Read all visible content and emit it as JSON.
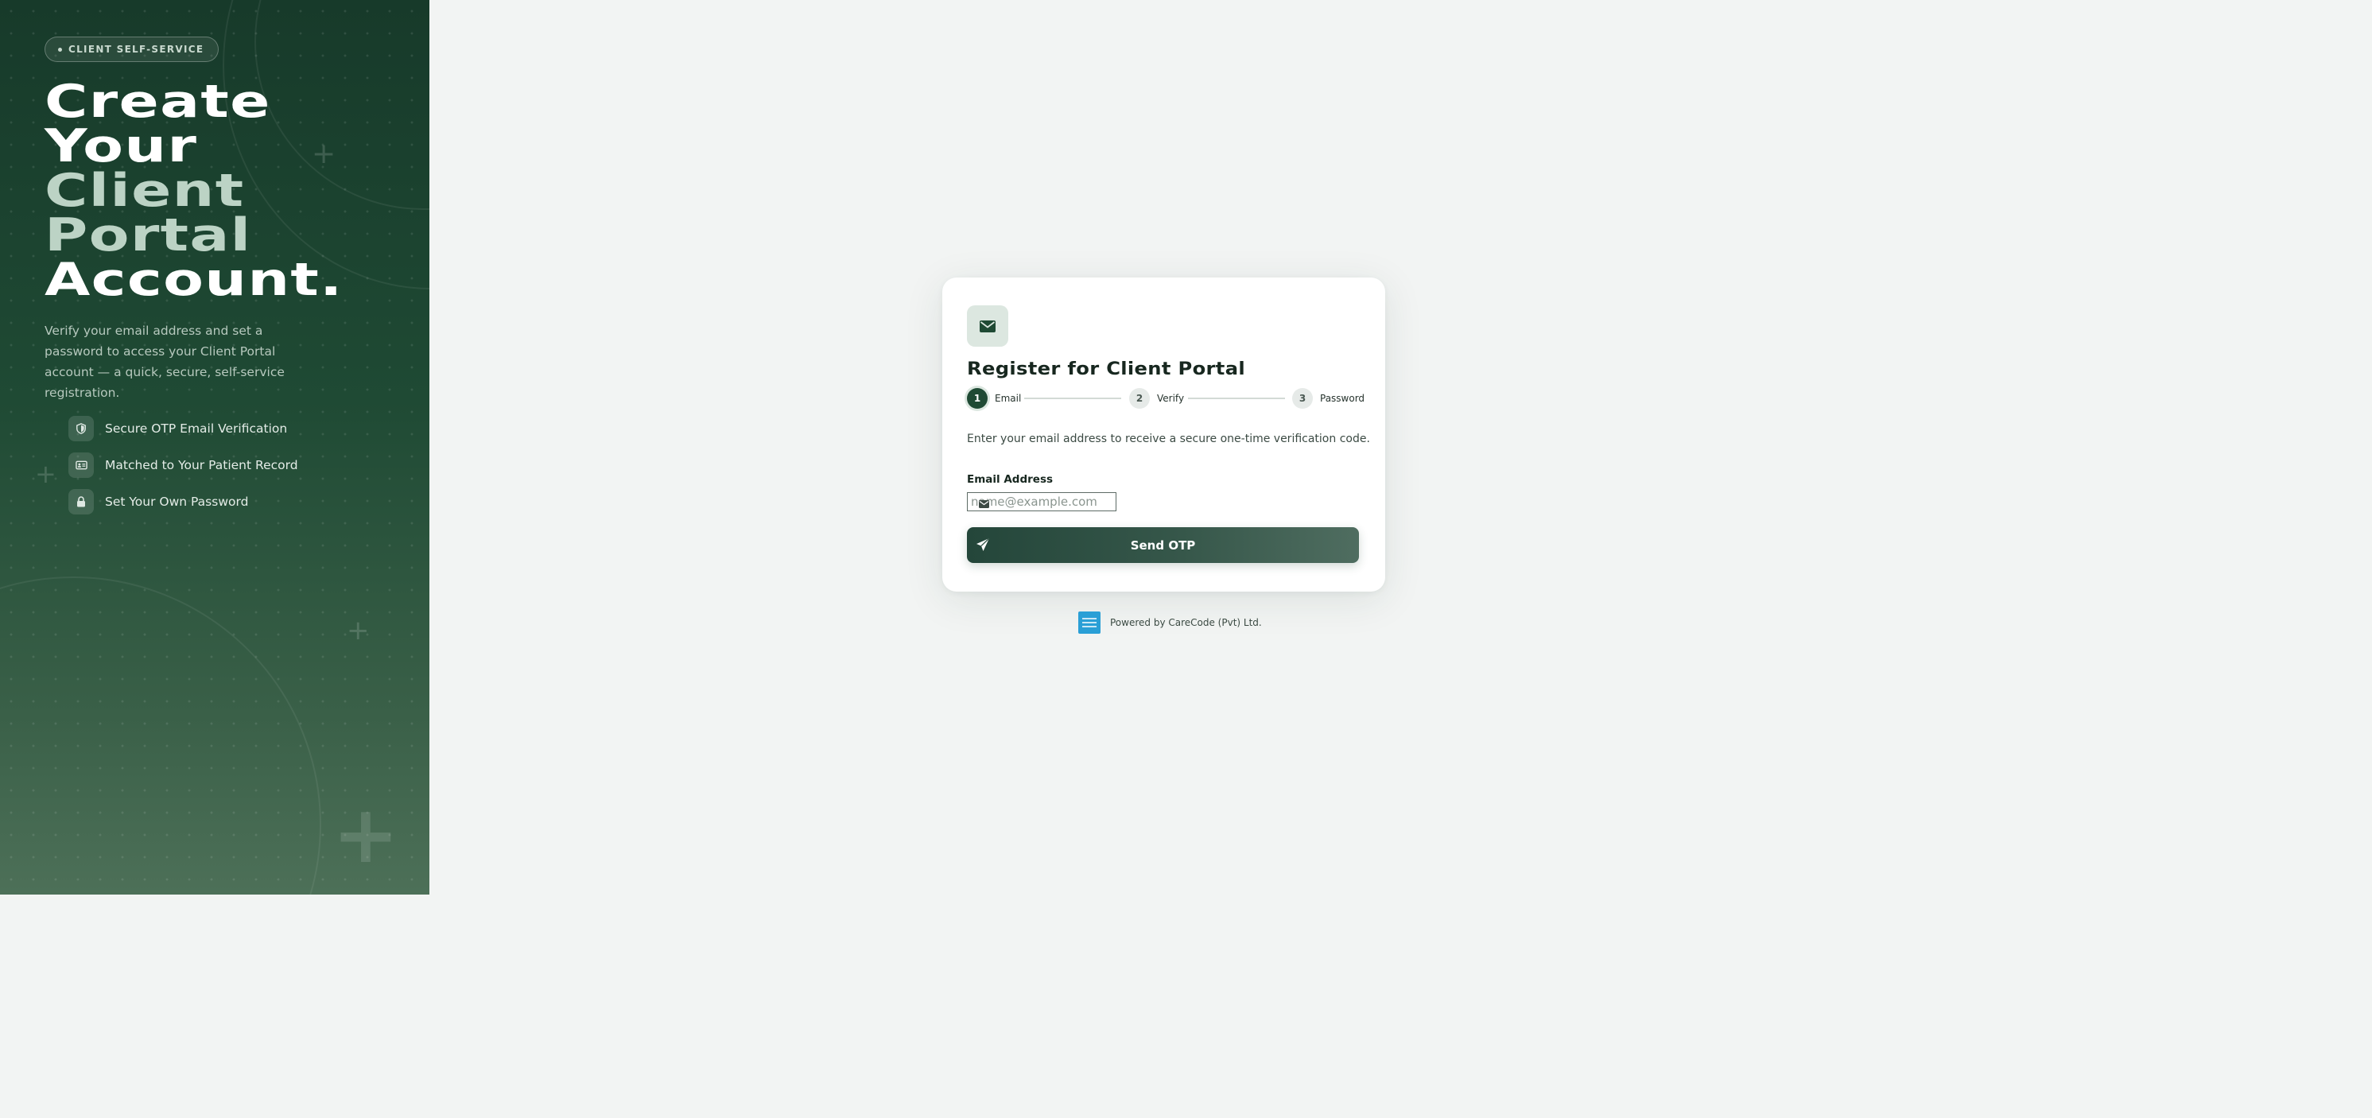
{
  "hero": {
    "badge": "CLIENT SELF-SERVICE",
    "headline": [
      {
        "text": "Create",
        "tone": "white"
      },
      {
        "text": "Your",
        "tone": "white"
      },
      {
        "text": "Client",
        "tone": "muted"
      },
      {
        "text": "Portal",
        "tone": "muted"
      },
      {
        "text": "Account.",
        "tone": "white"
      }
    ],
    "description": "Verify your email address and set a password to access your Client Portal account — a quick, secure, self-service registration.",
    "features": [
      {
        "icon": "shield-icon",
        "label": "Secure OTP Email Verification"
      },
      {
        "icon": "id-card-icon",
        "label": "Matched to Your Patient Record"
      },
      {
        "icon": "lock-icon",
        "label": "Set Your Own Password"
      }
    ]
  },
  "card": {
    "icon": "envelope-icon",
    "title": "Register for Client Portal",
    "steps": [
      {
        "num": "1",
        "label": "Email",
        "state": "active"
      },
      {
        "num": "2",
        "label": "Verify",
        "state": "pending"
      },
      {
        "num": "3",
        "label": "Password",
        "state": "pending"
      }
    ],
    "intro": "Enter your email address to receive a secure one-time verification code.",
    "email_label": "Email Address",
    "email_value": "",
    "email_placeholder": "name@example.com",
    "send_button": "Send OTP"
  },
  "footer": {
    "powered_by": "Powered by CareCode (Pvt) Ltd."
  },
  "colors": {
    "brand_dark": "#1f4a34",
    "accent_muted": "#bcd3c5",
    "page_bg": "#f2f4f3",
    "vendor_logo": "#2a9fd6"
  }
}
